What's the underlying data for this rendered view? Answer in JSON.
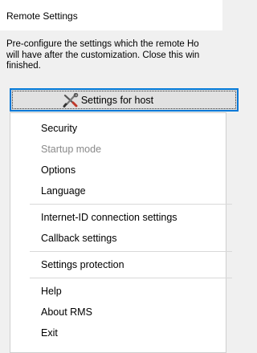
{
  "window": {
    "title": "Remote Settings"
  },
  "description": {
    "line1": "Pre-configure the settings which the remote Ho",
    "line2": "will have after the customization. Close this win",
    "line3": "finished."
  },
  "host_button": {
    "label": "Settings for host",
    "icon": "tools-icon"
  },
  "menu": {
    "items": [
      {
        "label": "Security",
        "enabled": true
      },
      {
        "label": "Startup mode",
        "enabled": false
      },
      {
        "label": "Options",
        "enabled": true
      },
      {
        "label": "Language",
        "enabled": true
      },
      {
        "label": "Internet-ID connection settings",
        "enabled": true
      },
      {
        "label": "Callback settings",
        "enabled": true
      },
      {
        "label": "Settings protection",
        "enabled": true
      },
      {
        "label": "Help",
        "enabled": true
      },
      {
        "label": "About RMS",
        "enabled": true
      },
      {
        "label": "Exit",
        "enabled": true
      }
    ]
  },
  "colors": {
    "focus_border": "#0078d7",
    "disabled_text": "#8a8a8a"
  }
}
